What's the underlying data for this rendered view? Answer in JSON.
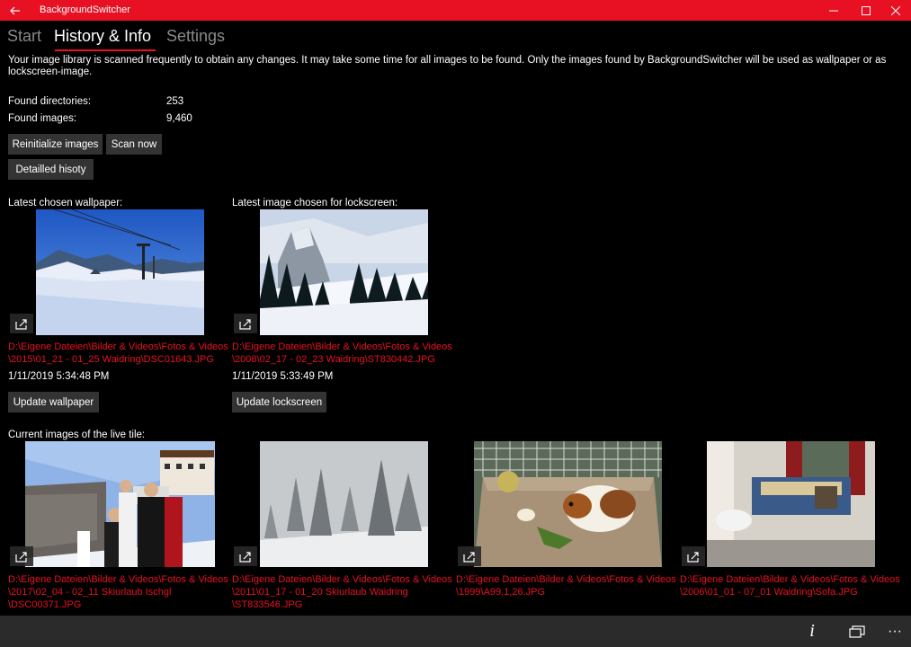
{
  "window": {
    "title": "BackgroundSwitcher",
    "accent_color": "#e81123"
  },
  "tabs": [
    {
      "label": "Start"
    },
    {
      "label": "History & Info"
    },
    {
      "label": "Settings"
    }
  ],
  "info": {
    "intro_text": "Your image library is scanned frequently to obtain any changes. It may take some time for all images to be found. Only the images found by BackgroundSwitcher will be used as wallpaper or as lockscreen-image.",
    "found_directories_label": "Found directories:",
    "found_directories_value": "253",
    "found_images_label": "Found images:",
    "found_images_value": "9,460"
  },
  "buttons": {
    "reinitialize": "Reinitialize images",
    "scan_now": "Scan now",
    "detailed_history": "Detailled hisoty",
    "update_wallpaper": "Update wallpaper",
    "update_lockscreen": "Update lockscreen"
  },
  "wallpaper": {
    "label": "Latest chosen wallpaper:",
    "path": "D:\\Eigene Dateien\\Bilder & Videos\\Fotos & Videos\n\\2015\\01_21 - 01_25 Waidring\\DSC01643.JPG",
    "datetime": "1/11/2019 5:34:48 PM"
  },
  "lockscreen": {
    "label": "Latest image chosen for lockscreen:",
    "path": "D:\\Eigene Dateien\\Bilder & Videos\\Fotos & Videos\n\\2008\\02_17 - 02_23 Waidring\\ST830442.JPG",
    "datetime": "1/11/2019 5:33:49 PM"
  },
  "live_tile": {
    "label": "Current images of the live tile:",
    "images": [
      {
        "path": "D:\\Eigene Dateien\\Bilder & Videos\\Fotos & Videos\n\\2017\\02_04 - 02_11 Skiurlaub Ischgl\n\\DSC00371.JPG"
      },
      {
        "path": "D:\\Eigene Dateien\\Bilder & Videos\\Fotos & Videos\n\\2011\\01_17 - 01_20 Skiurlaub Waidring\n\\ST833546.JPG"
      },
      {
        "path": "D:\\Eigene Dateien\\Bilder & Videos\\Fotos & Videos\n\\1999\\A99,1,26.JPG"
      },
      {
        "path": "D:\\Eigene Dateien\\Bilder & Videos\\Fotos & Videos\n\\2006\\01_01 - 07_01 Waidring\\Sofa.JPG"
      }
    ]
  },
  "appbar": {
    "info_glyph": "i",
    "more_glyph": "···"
  }
}
